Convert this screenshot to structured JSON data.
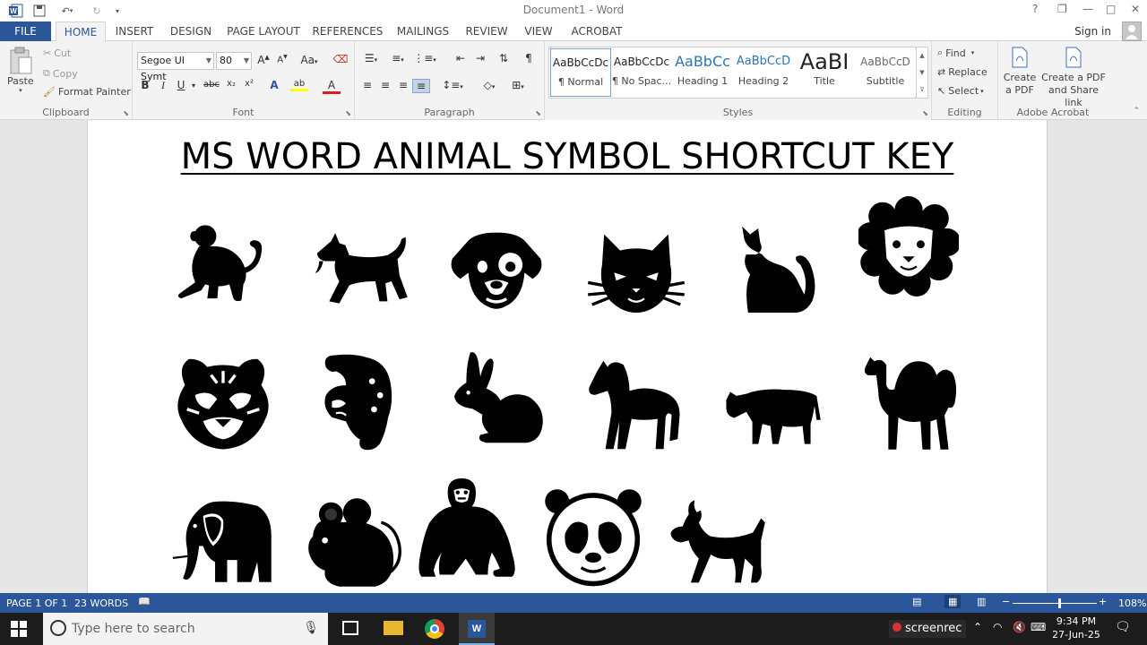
{
  "titlebar": {
    "title": "Document1 - Word",
    "help": "?",
    "restore": "❐",
    "minimize": "—",
    "maximize": "□",
    "close": "✕"
  },
  "tabs": [
    "FILE",
    "HOME",
    "INSERT",
    "DESIGN",
    "PAGE LAYOUT",
    "REFERENCES",
    "MAILINGS",
    "REVIEW",
    "VIEW",
    "ACROBAT"
  ],
  "account": {
    "signin": "Sign in"
  },
  "clipboard": {
    "paste": "Paste",
    "cut": "Cut",
    "copy": "Copy",
    "format_painter": "Format Painter",
    "label": "Clipboard"
  },
  "font": {
    "name": "Segoe UI Symt",
    "size": "80",
    "label": "Font",
    "grow": "A",
    "shrink": "A",
    "case": "Aa",
    "bold": "B",
    "italic": "I",
    "underline": "U",
    "strike": "abc",
    "sub": "x₂",
    "sup": "x²",
    "effects": "A",
    "highlight": "ab",
    "color": "A"
  },
  "paragraph": {
    "label": "Paragraph"
  },
  "styles": {
    "label": "Styles",
    "items": [
      {
        "preview": "AaBbCcDc",
        "name": "¶ Normal"
      },
      {
        "preview": "AaBbCcDc",
        "name": "¶ No Spac..."
      },
      {
        "preview": "AaBbCc",
        "name": "Heading 1"
      },
      {
        "preview": "AaBbCcD",
        "name": "Heading 2"
      },
      {
        "preview": "AaBI",
        "name": "Title"
      },
      {
        "preview": "AaBbCcD",
        "name": "Subtitle"
      }
    ]
  },
  "editing": {
    "find": "Find",
    "replace": "Replace",
    "select": "Select",
    "label": "Editing"
  },
  "acrobat": {
    "create_pdf": "Create a PDF",
    "create_share": "Create a PDF and Share link",
    "label": "Adobe Acrobat"
  },
  "document": {
    "heading": "MS WORD ANIMAL SYMBOL SHORTCUT KEY",
    "animals": [
      "monkey",
      "dog",
      "dog-face",
      "cat-face",
      "cat",
      "lion-face",
      "tiger-face",
      "leopard",
      "rabbit",
      "horse",
      "ox",
      "camel",
      "elephant",
      "mouse",
      "gorilla",
      "panda-face",
      "goat"
    ]
  },
  "status": {
    "page": "PAGE 1 OF 1",
    "words": "23 WORDS",
    "zoom": "108%",
    "zoom_level": 0.54
  },
  "taskbar": {
    "search_placeholder": "Type here to search",
    "recorder": "screenrec",
    "time": "9:34 PM",
    "date": "27-Jun-25"
  },
  "colors": {
    "accent": "#2b579a",
    "ribbon": "#f3f3f3",
    "taskbar": "#1c1c1c"
  }
}
